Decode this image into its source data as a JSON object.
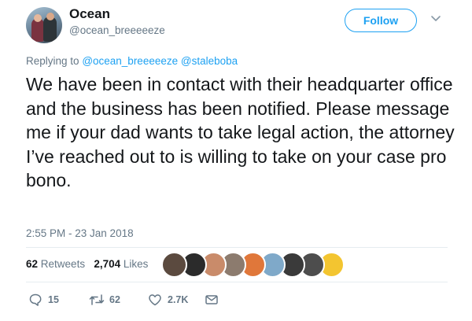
{
  "user": {
    "name": "Ocean",
    "handle": "@ocean_breeeeeze"
  },
  "header": {
    "follow_label": "Follow"
  },
  "reply": {
    "prefix": "Replying to",
    "mention1": "@ocean_breeeeeze",
    "mention2": "@staleboba"
  },
  "tweet": {
    "text": "We have been in contact with their headquarter office and the business has been notified. Please message me if your dad wants to take legal action, the attorney I’ve reached out to is willing to take on your case pro bono.",
    "timestamp": "2:55 PM - 23 Jan 2018"
  },
  "stats": {
    "retweets_count": "62",
    "retweets_label": "Retweets",
    "likes_count": "2,704",
    "likes_label": "Likes"
  },
  "likers": [
    {
      "color": "#5b4a3f"
    },
    {
      "color": "#2b2b2b"
    },
    {
      "color": "#c98b6a"
    },
    {
      "color": "#8c7b6e"
    },
    {
      "color": "#e0773a"
    },
    {
      "color": "#7fa9c9"
    },
    {
      "color": "#3a3a3a"
    },
    {
      "color": "#4d4d4d"
    },
    {
      "color": "#f3c530"
    }
  ],
  "actions": {
    "replies": "15",
    "retweets": "62",
    "likes": "2.7K"
  },
  "colors": {
    "accent": "#1da1f2",
    "secondary_text": "#657786"
  }
}
